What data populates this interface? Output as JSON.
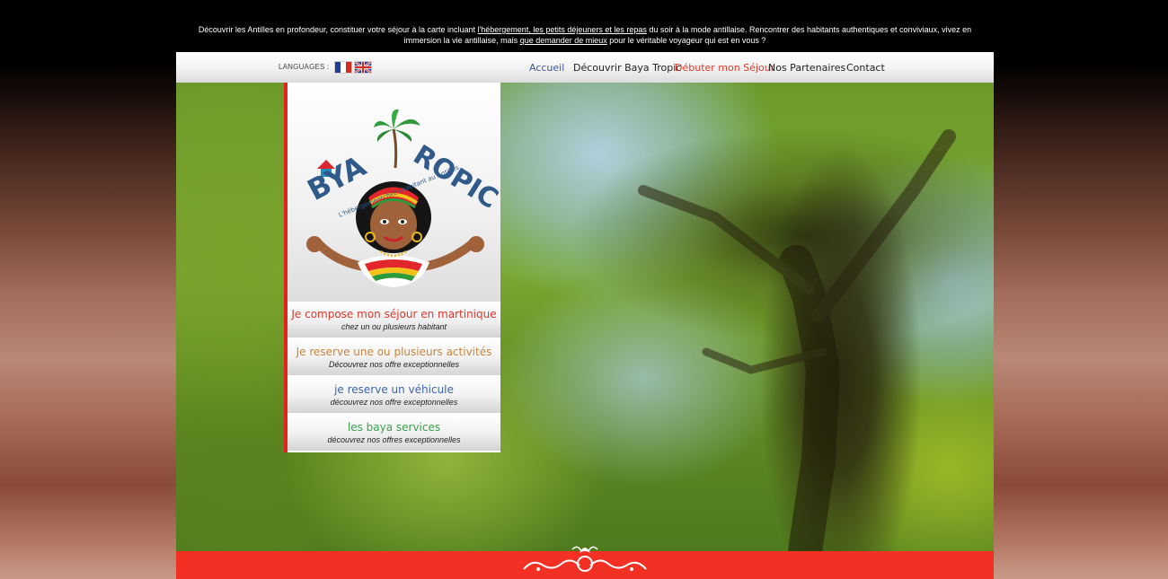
{
  "topbar": {
    "part1": "Découvrir les Antilles en profondeur, constituer votre séjour à la carte incluant ",
    "link1": "l'hébergement, les petits déjeuners et les repas",
    "part2": " du soir à la mode antillaise. Rencontrer des habitants authentiques et conviviaux, vivez en immersion la vie antillaise, mais ",
    "link2": "que demander de mieux",
    "part3": " pour le véritable voyageur qui est en vous ?"
  },
  "nav": {
    "languages_label": "LANGUAGES :",
    "flags": [
      "french-flag-icon",
      "uk-flag-icon"
    ],
    "items": [
      {
        "label": "Accueil"
      },
      {
        "label": "Découvrir Baya Tropic"
      },
      {
        "label": "Débuter mon Séjour"
      },
      {
        "label": "Nos Partenaires"
      },
      {
        "label": "Contact"
      }
    ]
  },
  "logo": {
    "brand_part1": "B",
    "brand_part2": "YA ",
    "brand_part3": "ROPIC",
    "tagline": "L'hébergementchez l'habitant au Antilles"
  },
  "sidebar_menu": [
    {
      "title": "Je compose mon séjour en martinique",
      "subtitle": "chez un ou plusieurs habitant"
    },
    {
      "title": "Je reserve une ou plusieurs activités",
      "subtitle": "Découvrez nos offre exceptionnelles"
    },
    {
      "title": "je reserve un véhicule",
      "subtitle": "découvrez nos offre exceptonnelles"
    },
    {
      "title": "les baya services",
      "subtitle": "découvrez nos offres exceptionnelles"
    }
  ],
  "colors": {
    "accent_red": "#f23124",
    "nav_active": "#3a5a9a",
    "nav_highlight": "#e03a2a",
    "item_orange": "#c8843c",
    "item_blue": "#3a64b0",
    "item_green": "#3aa04a"
  }
}
